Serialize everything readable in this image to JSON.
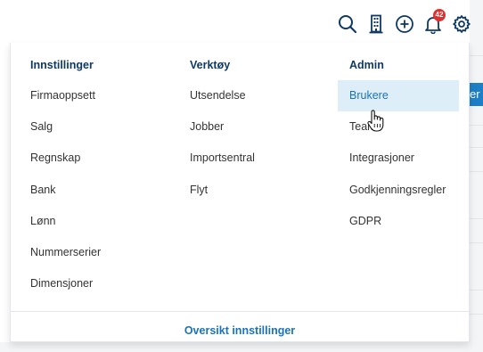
{
  "toolbar": {
    "icons": [
      "search-icon",
      "building-icon",
      "add-circle-icon",
      "bell-icon",
      "gear-icon"
    ],
    "notification_count": "42"
  },
  "background": {
    "button_fragment": "er"
  },
  "menu": {
    "columns": [
      {
        "heading": "Innstillinger",
        "items": [
          "Firmaoppsett",
          "Salg",
          "Regnskap",
          "Bank",
          "Lønn",
          "Nummerserier",
          "Dimensjoner"
        ]
      },
      {
        "heading": "Verktøy",
        "items": [
          "Utsendelse",
          "Jobber",
          "Importsentral",
          "Flyt"
        ]
      },
      {
        "heading": "Admin",
        "items": [
          "Brukere",
          "Team",
          "Integrasjoner",
          "Godkjenningsregler",
          "GDPR"
        ]
      }
    ],
    "active_item": "Brukere",
    "footer_link": "Oversikt innstillinger"
  },
  "colors": {
    "heading": "#0f3a63",
    "link": "#1a73b8",
    "active_bg": "#deeef8",
    "badge": "#e03131"
  }
}
